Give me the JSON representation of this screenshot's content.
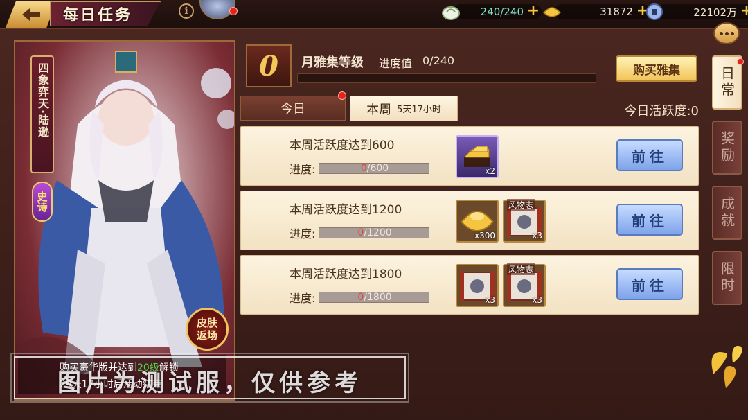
{
  "header": {
    "title": "每日任务",
    "stamina": "240/240",
    "gold": "31872",
    "coins": "22102万"
  },
  "hero": {
    "name": "四象弈天·陆逊",
    "rarity": "史诗",
    "skin_badge": "皮肤返场",
    "unlock_prefix": "购买豪华版并达到",
    "unlock_level": "20级",
    "unlock_suffix": "解锁",
    "countdown": "29天17小时后活动结束"
  },
  "watermark": "图片为测试服，仅供参考",
  "pass": {
    "level": "0",
    "title": "月雅集等级",
    "progress_label": "进度值",
    "progress_value": "0/240",
    "progress_fraction": 0,
    "buy_label": "购买雅集"
  },
  "tabs": {
    "today": "今日",
    "week": "本周",
    "week_timer": "5天17小时",
    "active_label": "今日活跃度:0"
  },
  "tasks": [
    {
      "name": "本周活跃度达到600",
      "progress_label": "进度:",
      "current": "0",
      "target": "/600",
      "go_label": "前往",
      "rewards": [
        {
          "icon": "gold-bars-icon",
          "qty": "x2",
          "tag": ""
        }
      ]
    },
    {
      "name": "本周活跃度达到1200",
      "progress_label": "进度:",
      "current": "0",
      "target": "/1200",
      "go_label": "前往",
      "rewards": [
        {
          "icon": "gold-ingot-icon",
          "qty": "x300",
          "tag": ""
        },
        {
          "icon": "scroll-icon",
          "qty": "x3",
          "tag": "风物志"
        }
      ]
    },
    {
      "name": "本周活跃度达到1800",
      "progress_label": "进度:",
      "current": "0",
      "target": "/1800",
      "go_label": "前往",
      "rewards": [
        {
          "icon": "scroll-icon",
          "qty": "x3",
          "tag": ""
        },
        {
          "icon": "scroll-icon",
          "qty": "x3",
          "tag": "风物志"
        }
      ]
    }
  ],
  "side_tabs": [
    "日常",
    "奖励",
    "成就",
    "限时"
  ],
  "colors": {
    "accent_gold": "#f4c75a",
    "go_button": "#7da3ea",
    "alert_red": "#e3241c",
    "unlock_level": "#52d94a"
  }
}
